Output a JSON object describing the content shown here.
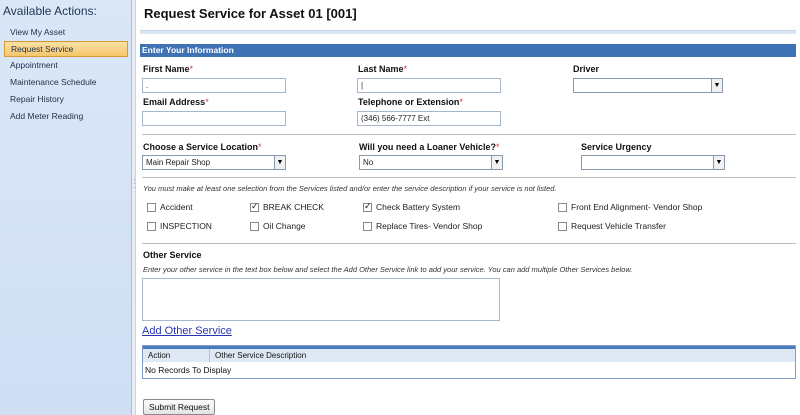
{
  "sidebar": {
    "title": "Available Actions:",
    "items": [
      {
        "label": "View My Asset"
      },
      {
        "label": "Request Service"
      },
      {
        "label": "Appointment"
      },
      {
        "label": "Maintenance Schedule"
      },
      {
        "label": "Repair History"
      },
      {
        "label": "Add Meter Reading"
      }
    ],
    "active_index": 1
  },
  "page": {
    "title": "Request Service for Asset 01 [001]",
    "section_title": "Enter Your Information"
  },
  "form": {
    "first_name": {
      "label": "First Name",
      "value": "."
    },
    "last_name": {
      "label": "Last Name",
      "value": "|"
    },
    "driver": {
      "label": "Driver",
      "value": ""
    },
    "email": {
      "label": "Email Address",
      "value": ""
    },
    "phone": {
      "label": "Telephone or Extension",
      "value": "(346) 566-7777 Ext"
    },
    "service_location": {
      "label": "Choose a Service Location",
      "value": "Main Repair Shop"
    },
    "loaner": {
      "label": "Will you need a Loaner Vehicle?",
      "value": "No"
    },
    "urgency": {
      "label": "Service Urgency",
      "value": ""
    },
    "required_marker": "*"
  },
  "services": {
    "note": "You must make at least one selection from the Services listed and/or enter the service description if your service is not listed.",
    "options": [
      {
        "label": "Accident",
        "checked": false
      },
      {
        "label": "BREAK CHECK",
        "checked": true
      },
      {
        "label": "Check Battery System",
        "checked": true
      },
      {
        "label": "Front End Alignment- Vendor Shop",
        "checked": false
      },
      {
        "label": "INSPECTION",
        "checked": false
      },
      {
        "label": "Oil Change",
        "checked": false
      },
      {
        "label": "Replace Tires- Vendor Shop",
        "checked": false
      },
      {
        "label": "Request Vehicle Transfer",
        "checked": false
      }
    ]
  },
  "other_service": {
    "heading": "Other Service",
    "note": "Enter your other service in the text box below and select the Add Other Service link to add your service. You can add multiple Other Services below.",
    "value": "",
    "add_link": "Add Other Service",
    "table": {
      "columns": [
        "Action",
        "Other Service Description"
      ],
      "empty_text": "No Records To Display"
    }
  },
  "submit_label": "Submit Request"
}
